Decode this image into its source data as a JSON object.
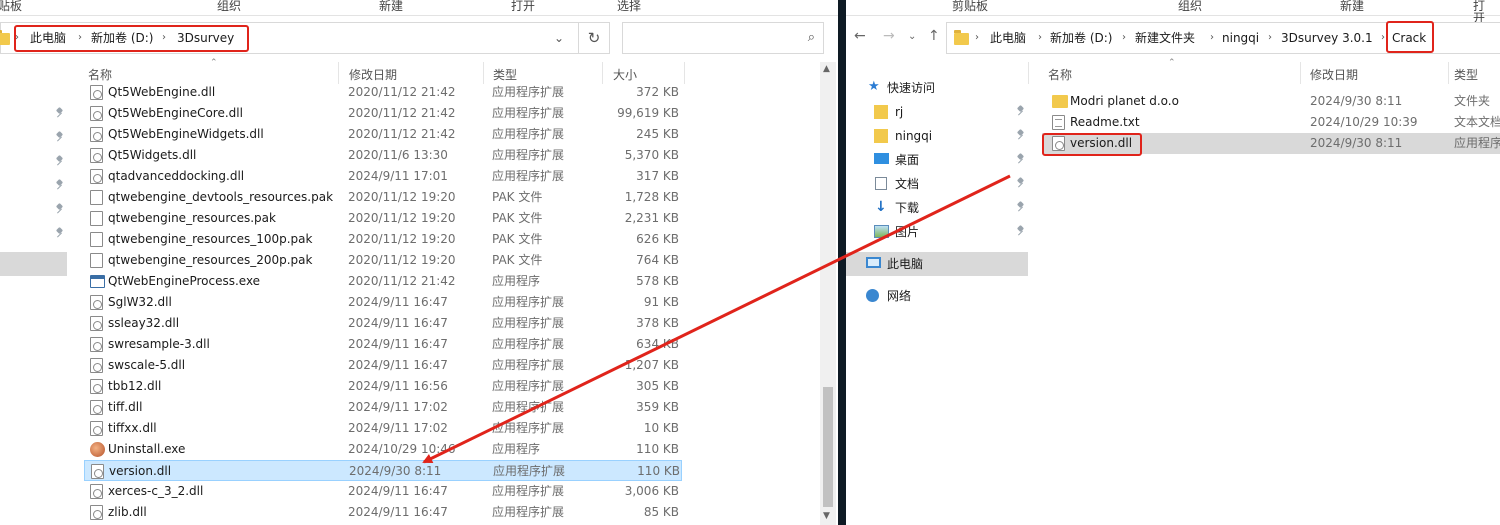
{
  "left": {
    "ribbon": [
      "贴板",
      "组织",
      "新建",
      "打开",
      "选择"
    ],
    "breadcrumb": [
      "此电脑",
      "新加卷 (D:)",
      "3Dsurvey"
    ],
    "columns": {
      "name": "名称",
      "date": "修改日期",
      "type": "类型",
      "size": "大小"
    },
    "rows": [
      {
        "name": "Qt5WebEngine.dll",
        "date": "2020/11/12 21:42",
        "type": "应用程序扩展",
        "size": "372 KB",
        "icon": "dll-icon"
      },
      {
        "name": "Qt5WebEngineCore.dll",
        "date": "2020/11/12 21:42",
        "type": "应用程序扩展",
        "size": "99,619 KB",
        "icon": "dll-icon"
      },
      {
        "name": "Qt5WebEngineWidgets.dll",
        "date": "2020/11/12 21:42",
        "type": "应用程序扩展",
        "size": "245 KB",
        "icon": "dll-icon"
      },
      {
        "name": "Qt5Widgets.dll",
        "date": "2020/11/6 13:30",
        "type": "应用程序扩展",
        "size": "5,370 KB",
        "icon": "dll-icon"
      },
      {
        "name": "qtadvanceddocking.dll",
        "date": "2024/9/11 17:01",
        "type": "应用程序扩展",
        "size": "317 KB",
        "icon": "dll-icon"
      },
      {
        "name": "qtwebengine_devtools_resources.pak",
        "date": "2020/11/12 19:20",
        "type": "PAK 文件",
        "size": "1,728 KB",
        "icon": "file-icon"
      },
      {
        "name": "qtwebengine_resources.pak",
        "date": "2020/11/12 19:20",
        "type": "PAK 文件",
        "size": "2,231 KB",
        "icon": "file-icon"
      },
      {
        "name": "qtwebengine_resources_100p.pak",
        "date": "2020/11/12 19:20",
        "type": "PAK 文件",
        "size": "626 KB",
        "icon": "file-icon"
      },
      {
        "name": "qtwebengine_resources_200p.pak",
        "date": "2020/11/12 19:20",
        "type": "PAK 文件",
        "size": "764 KB",
        "icon": "file-icon"
      },
      {
        "name": "QtWebEngineProcess.exe",
        "date": "2020/11/12 21:42",
        "type": "应用程序",
        "size": "578 KB",
        "icon": "exe-icon"
      },
      {
        "name": "SglW32.dll",
        "date": "2024/9/11 16:47",
        "type": "应用程序扩展",
        "size": "91 KB",
        "icon": "dll-icon"
      },
      {
        "name": "ssleay32.dll",
        "date": "2024/9/11 16:47",
        "type": "应用程序扩展",
        "size": "378 KB",
        "icon": "dll-icon"
      },
      {
        "name": "swresample-3.dll",
        "date": "2024/9/11 16:47",
        "type": "应用程序扩展",
        "size": "634 KB",
        "icon": "dll-icon"
      },
      {
        "name": "swscale-5.dll",
        "date": "2024/9/11 16:47",
        "type": "应用程序扩展",
        "size": "1,207 KB",
        "icon": "dll-icon"
      },
      {
        "name": "tbb12.dll",
        "date": "2024/9/11 16:56",
        "type": "应用程序扩展",
        "size": "305 KB",
        "icon": "dll-icon"
      },
      {
        "name": "tiff.dll",
        "date": "2024/9/11 17:02",
        "type": "应用程序扩展",
        "size": "359 KB",
        "icon": "dll-icon"
      },
      {
        "name": "tiffxx.dll",
        "date": "2024/9/11 17:02",
        "type": "应用程序扩展",
        "size": "10 KB",
        "icon": "dll-icon"
      },
      {
        "name": "Uninstall.exe",
        "date": "2024/10/29 10:46",
        "type": "应用程序",
        "size": "110 KB",
        "icon": "uninstall-icon"
      },
      {
        "name": "version.dll",
        "date": "2024/9/30 8:11",
        "type": "应用程序扩展",
        "size": "110 KB",
        "icon": "dll-icon",
        "selected": true
      },
      {
        "name": "xerces-c_3_2.dll",
        "date": "2024/9/11 16:47",
        "type": "应用程序扩展",
        "size": "3,006 KB",
        "icon": "dll-icon"
      },
      {
        "name": "zlib.dll",
        "date": "2024/9/11 16:47",
        "type": "应用程序扩展",
        "size": "85 KB",
        "icon": "dll-icon"
      }
    ]
  },
  "right": {
    "ribbon": [
      "剪贴板",
      "组织",
      "新建",
      "打开"
    ],
    "breadcrumb": [
      "此电脑",
      "新加卷 (D:)",
      "新建文件夹",
      "ningqi",
      "3Dsurvey 3.0.1",
      "Crack"
    ],
    "columns": {
      "name": "名称",
      "date": "修改日期",
      "type": "类型"
    },
    "nav": [
      {
        "label": "快速访问",
        "icon": "star-icon"
      },
      {
        "label": "rj",
        "icon": "folder-icon",
        "pinned": true
      },
      {
        "label": "ningqi",
        "icon": "folder-icon",
        "pinned": true
      },
      {
        "label": "桌面",
        "icon": "desktop-icon",
        "pinned": true
      },
      {
        "label": "文档",
        "icon": "document-icon",
        "pinned": true
      },
      {
        "label": "下载",
        "icon": "download-icon",
        "pinned": true
      },
      {
        "label": "图片",
        "icon": "picture-icon",
        "pinned": true
      },
      {
        "label": "此电脑",
        "icon": "computer-icon",
        "selected": true
      },
      {
        "label": "网络",
        "icon": "network-icon"
      }
    ],
    "rows": [
      {
        "name": "Modri planet d.o.o",
        "date": "2024/9/30 8:11",
        "type": "文件夹",
        "icon": "folder-icon"
      },
      {
        "name": "Readme.txt",
        "date": "2024/10/29 10:39",
        "type": "文本文档",
        "icon": "txt-icon"
      },
      {
        "name": "version.dll",
        "date": "2024/9/30 8:11",
        "type": "应用程序",
        "icon": "dll-icon",
        "selected": true
      }
    ]
  },
  "colors": {
    "annotation": "#e0241b",
    "selection": "#cce8ff"
  }
}
